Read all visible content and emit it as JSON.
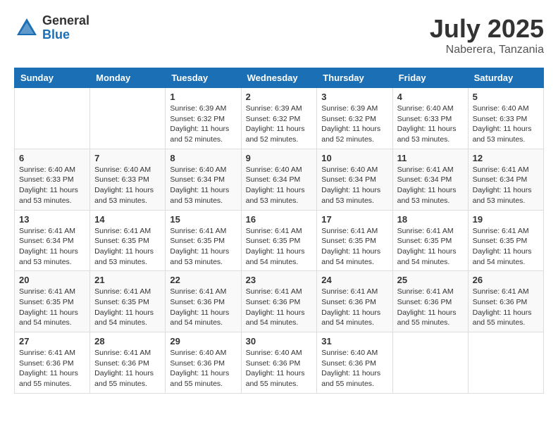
{
  "header": {
    "logo_general": "General",
    "logo_blue": "Blue",
    "title": "July 2025",
    "location": "Naberera, Tanzania"
  },
  "calendar": {
    "days_of_week": [
      "Sunday",
      "Monday",
      "Tuesday",
      "Wednesday",
      "Thursday",
      "Friday",
      "Saturday"
    ],
    "weeks": [
      [
        {
          "day": "",
          "info": ""
        },
        {
          "day": "",
          "info": ""
        },
        {
          "day": "1",
          "info": "Sunrise: 6:39 AM\nSunset: 6:32 PM\nDaylight: 11 hours\nand 52 minutes."
        },
        {
          "day": "2",
          "info": "Sunrise: 6:39 AM\nSunset: 6:32 PM\nDaylight: 11 hours\nand 52 minutes."
        },
        {
          "day": "3",
          "info": "Sunrise: 6:39 AM\nSunset: 6:32 PM\nDaylight: 11 hours\nand 52 minutes."
        },
        {
          "day": "4",
          "info": "Sunrise: 6:40 AM\nSunset: 6:33 PM\nDaylight: 11 hours\nand 53 minutes."
        },
        {
          "day": "5",
          "info": "Sunrise: 6:40 AM\nSunset: 6:33 PM\nDaylight: 11 hours\nand 53 minutes."
        }
      ],
      [
        {
          "day": "6",
          "info": "Sunrise: 6:40 AM\nSunset: 6:33 PM\nDaylight: 11 hours\nand 53 minutes."
        },
        {
          "day": "7",
          "info": "Sunrise: 6:40 AM\nSunset: 6:33 PM\nDaylight: 11 hours\nand 53 minutes."
        },
        {
          "day": "8",
          "info": "Sunrise: 6:40 AM\nSunset: 6:34 PM\nDaylight: 11 hours\nand 53 minutes."
        },
        {
          "day": "9",
          "info": "Sunrise: 6:40 AM\nSunset: 6:34 PM\nDaylight: 11 hours\nand 53 minutes."
        },
        {
          "day": "10",
          "info": "Sunrise: 6:40 AM\nSunset: 6:34 PM\nDaylight: 11 hours\nand 53 minutes."
        },
        {
          "day": "11",
          "info": "Sunrise: 6:41 AM\nSunset: 6:34 PM\nDaylight: 11 hours\nand 53 minutes."
        },
        {
          "day": "12",
          "info": "Sunrise: 6:41 AM\nSunset: 6:34 PM\nDaylight: 11 hours\nand 53 minutes."
        }
      ],
      [
        {
          "day": "13",
          "info": "Sunrise: 6:41 AM\nSunset: 6:34 PM\nDaylight: 11 hours\nand 53 minutes."
        },
        {
          "day": "14",
          "info": "Sunrise: 6:41 AM\nSunset: 6:35 PM\nDaylight: 11 hours\nand 53 minutes."
        },
        {
          "day": "15",
          "info": "Sunrise: 6:41 AM\nSunset: 6:35 PM\nDaylight: 11 hours\nand 53 minutes."
        },
        {
          "day": "16",
          "info": "Sunrise: 6:41 AM\nSunset: 6:35 PM\nDaylight: 11 hours\nand 54 minutes."
        },
        {
          "day": "17",
          "info": "Sunrise: 6:41 AM\nSunset: 6:35 PM\nDaylight: 11 hours\nand 54 minutes."
        },
        {
          "day": "18",
          "info": "Sunrise: 6:41 AM\nSunset: 6:35 PM\nDaylight: 11 hours\nand 54 minutes."
        },
        {
          "day": "19",
          "info": "Sunrise: 6:41 AM\nSunset: 6:35 PM\nDaylight: 11 hours\nand 54 minutes."
        }
      ],
      [
        {
          "day": "20",
          "info": "Sunrise: 6:41 AM\nSunset: 6:35 PM\nDaylight: 11 hours\nand 54 minutes."
        },
        {
          "day": "21",
          "info": "Sunrise: 6:41 AM\nSunset: 6:35 PM\nDaylight: 11 hours\nand 54 minutes."
        },
        {
          "day": "22",
          "info": "Sunrise: 6:41 AM\nSunset: 6:36 PM\nDaylight: 11 hours\nand 54 minutes."
        },
        {
          "day": "23",
          "info": "Sunrise: 6:41 AM\nSunset: 6:36 PM\nDaylight: 11 hours\nand 54 minutes."
        },
        {
          "day": "24",
          "info": "Sunrise: 6:41 AM\nSunset: 6:36 PM\nDaylight: 11 hours\nand 54 minutes."
        },
        {
          "day": "25",
          "info": "Sunrise: 6:41 AM\nSunset: 6:36 PM\nDaylight: 11 hours\nand 55 minutes."
        },
        {
          "day": "26",
          "info": "Sunrise: 6:41 AM\nSunset: 6:36 PM\nDaylight: 11 hours\nand 55 minutes."
        }
      ],
      [
        {
          "day": "27",
          "info": "Sunrise: 6:41 AM\nSunset: 6:36 PM\nDaylight: 11 hours\nand 55 minutes."
        },
        {
          "day": "28",
          "info": "Sunrise: 6:41 AM\nSunset: 6:36 PM\nDaylight: 11 hours\nand 55 minutes."
        },
        {
          "day": "29",
          "info": "Sunrise: 6:40 AM\nSunset: 6:36 PM\nDaylight: 11 hours\nand 55 minutes."
        },
        {
          "day": "30",
          "info": "Sunrise: 6:40 AM\nSunset: 6:36 PM\nDaylight: 11 hours\nand 55 minutes."
        },
        {
          "day": "31",
          "info": "Sunrise: 6:40 AM\nSunset: 6:36 PM\nDaylight: 11 hours\nand 55 minutes."
        },
        {
          "day": "",
          "info": ""
        },
        {
          "day": "",
          "info": ""
        }
      ]
    ]
  }
}
